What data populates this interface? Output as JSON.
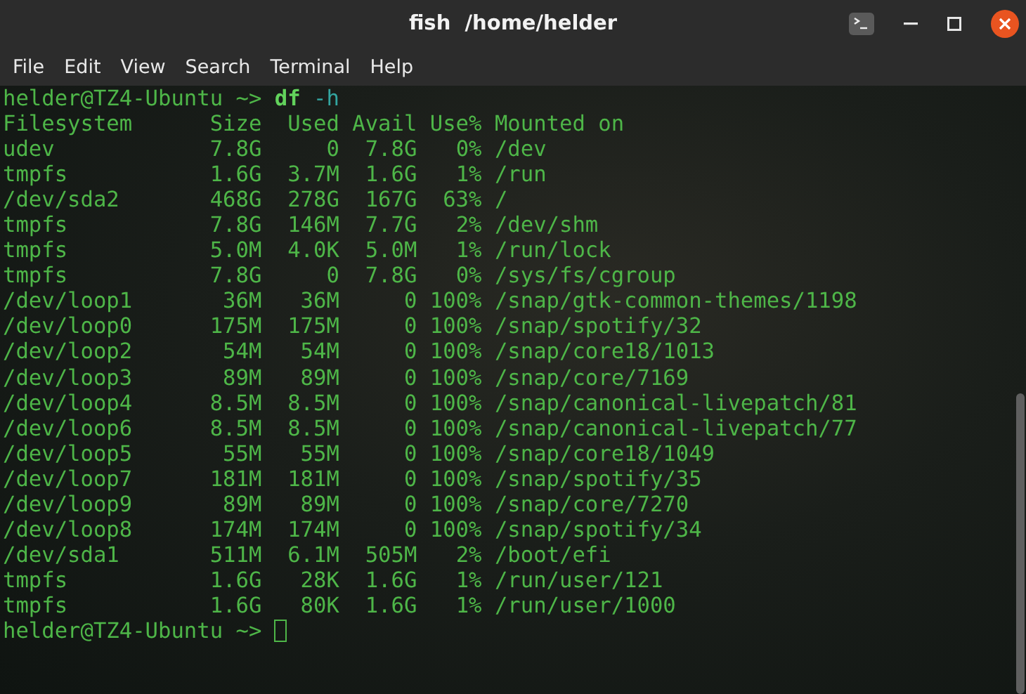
{
  "window": {
    "title": "fish  /home/helder"
  },
  "menu": [
    "File",
    "Edit",
    "View",
    "Search",
    "Terminal",
    "Help"
  ],
  "terminal": {
    "command_prompt": {
      "prompt": "helder@TZ4-Ubuntu ~>",
      "command": "df",
      "args": "-h"
    },
    "df_output": {
      "columns": [
        "Filesystem",
        "Size",
        "Used",
        "Avail",
        "Use%",
        "Mounted on"
      ],
      "rows": [
        [
          "udev",
          "7.8G",
          "0",
          "7.8G",
          "0%",
          "/dev"
        ],
        [
          "tmpfs",
          "1.6G",
          "3.7M",
          "1.6G",
          "1%",
          "/run"
        ],
        [
          "/dev/sda2",
          "468G",
          "278G",
          "167G",
          "63%",
          "/"
        ],
        [
          "tmpfs",
          "7.8G",
          "146M",
          "7.7G",
          "2%",
          "/dev/shm"
        ],
        [
          "tmpfs",
          "5.0M",
          "4.0K",
          "5.0M",
          "1%",
          "/run/lock"
        ],
        [
          "tmpfs",
          "7.8G",
          "0",
          "7.8G",
          "0%",
          "/sys/fs/cgroup"
        ],
        [
          "/dev/loop1",
          "36M",
          "36M",
          "0",
          "100%",
          "/snap/gtk-common-themes/1198"
        ],
        [
          "/dev/loop0",
          "175M",
          "175M",
          "0",
          "100%",
          "/snap/spotify/32"
        ],
        [
          "/dev/loop2",
          "54M",
          "54M",
          "0",
          "100%",
          "/snap/core18/1013"
        ],
        [
          "/dev/loop3",
          "89M",
          "89M",
          "0",
          "100%",
          "/snap/core/7169"
        ],
        [
          "/dev/loop4",
          "8.5M",
          "8.5M",
          "0",
          "100%",
          "/snap/canonical-livepatch/81"
        ],
        [
          "/dev/loop6",
          "8.5M",
          "8.5M",
          "0",
          "100%",
          "/snap/canonical-livepatch/77"
        ],
        [
          "/dev/loop5",
          "55M",
          "55M",
          "0",
          "100%",
          "/snap/core18/1049"
        ],
        [
          "/dev/loop7",
          "181M",
          "181M",
          "0",
          "100%",
          "/snap/spotify/35"
        ],
        [
          "/dev/loop9",
          "89M",
          "89M",
          "0",
          "100%",
          "/snap/core/7270"
        ],
        [
          "/dev/loop8",
          "174M",
          "174M",
          "0",
          "100%",
          "/snap/spotify/34"
        ],
        [
          "/dev/sda1",
          "511M",
          "6.1M",
          "505M",
          "2%",
          "/boot/efi"
        ],
        [
          "tmpfs",
          "1.6G",
          "28K",
          "1.6G",
          "1%",
          "/run/user/121"
        ],
        [
          "tmpfs",
          "1.6G",
          "80K",
          "1.6G",
          "1%",
          "/run/user/1000"
        ]
      ]
    },
    "current_prompt": {
      "prompt": "helder@TZ4-Ubuntu ~>"
    }
  }
}
